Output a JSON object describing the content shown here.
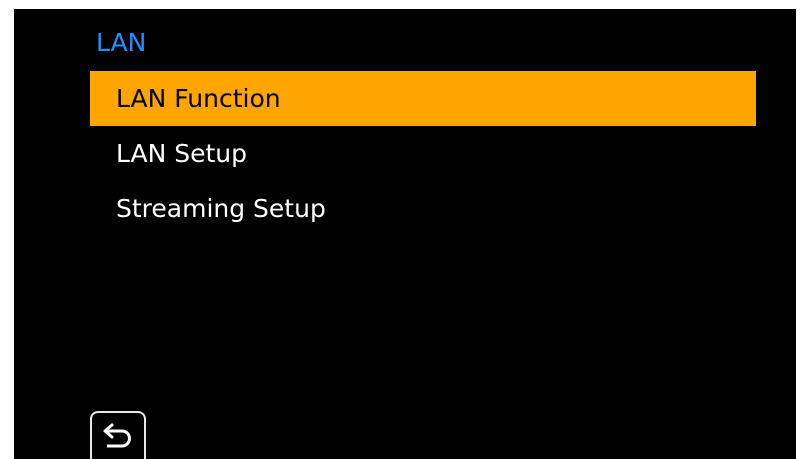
{
  "menu": {
    "title": "LAN",
    "items": [
      {
        "label": "LAN Function",
        "selected": true
      },
      {
        "label": "LAN Setup",
        "selected": false
      },
      {
        "label": "Streaming Setup",
        "selected": false
      }
    ]
  },
  "footer": {
    "back_icon": "return-arrow-icon"
  },
  "colors": {
    "background": "#000000",
    "title": "#1e90ff",
    "highlight": "#ffa500",
    "text": "#ffffff",
    "highlight_text": "#000000"
  }
}
